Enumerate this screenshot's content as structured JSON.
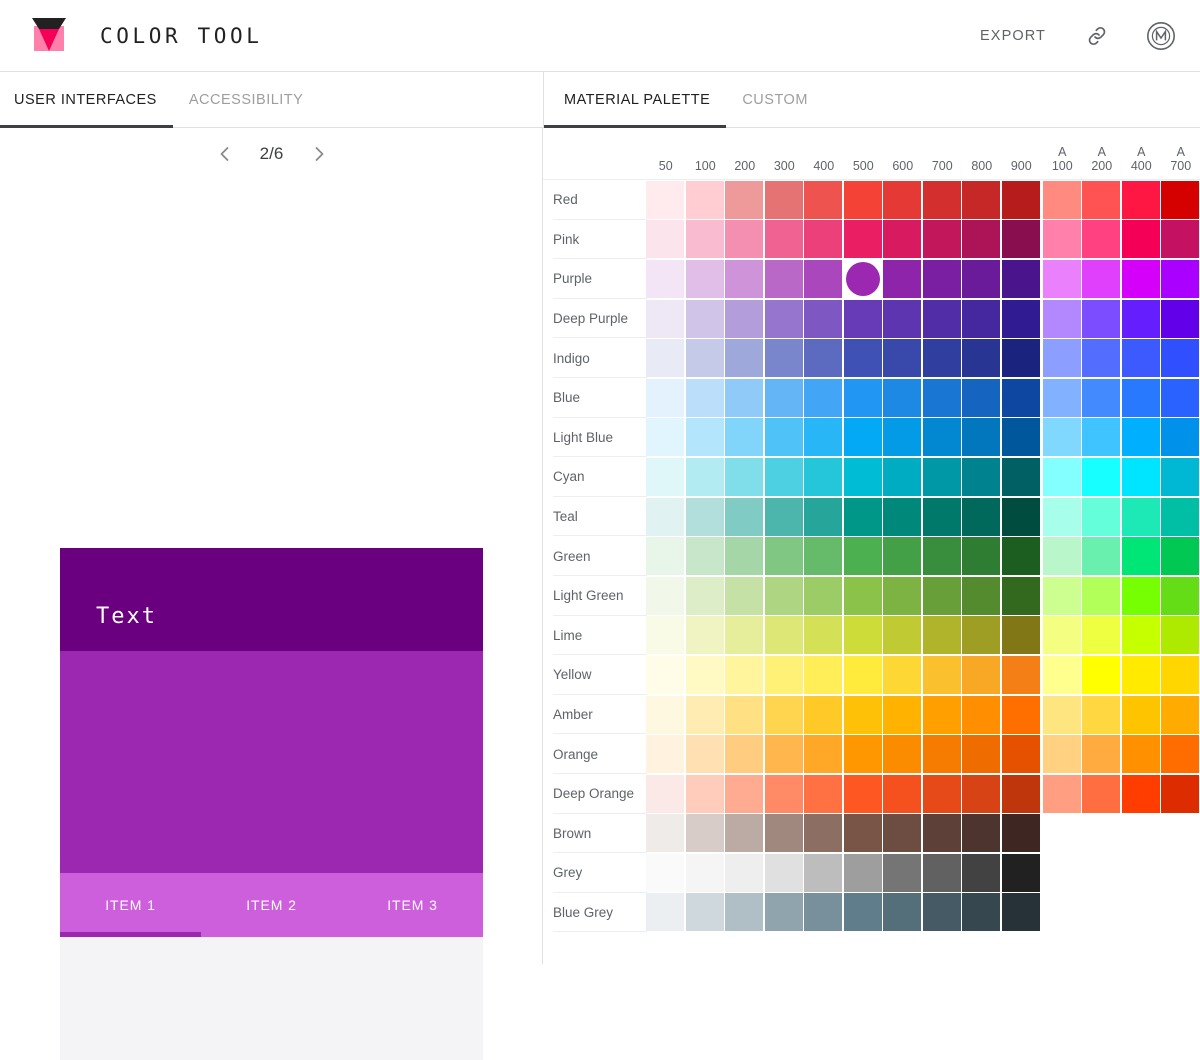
{
  "app": {
    "title": "COLOR TOOL",
    "logo_icon": "color-tool-logo-icon",
    "export_label": "EXPORT",
    "link_icon": "link-icon",
    "material_icon": "material-design-m-icon"
  },
  "left_tabs": [
    {
      "label": "USER INTERFACES",
      "active": true
    },
    {
      "label": "ACCESSIBILITY",
      "active": false
    }
  ],
  "right_tabs": [
    {
      "label": "MATERIAL PALETTE",
      "active": true
    },
    {
      "label": "CUSTOM",
      "active": false
    }
  ],
  "pager": {
    "prev_icon": "chevron-left-icon",
    "next_icon": "chevron-right-icon",
    "label": "2/6",
    "current": 2,
    "total": 6
  },
  "mockup": {
    "appbar_text": "Text",
    "appbar_color": "#6A0080",
    "body_color": "#9C27B0",
    "tabbar_color": "#CE5FDC",
    "indicator_color": "#9C27B0",
    "content_color": "#F4F4F6",
    "on_appbar_text_color": "#FFFFFF",
    "tabs": [
      {
        "label": "ITEM 1",
        "active": true
      },
      {
        "label": "ITEM 2",
        "active": false
      },
      {
        "label": "ITEM 3",
        "active": false
      }
    ]
  },
  "palette": {
    "selected": {
      "row": "Purple",
      "column": "500",
      "color": "#9C27B0"
    },
    "columns": [
      "50",
      "100",
      "200",
      "300",
      "400",
      "500",
      "600",
      "700",
      "800",
      "900"
    ],
    "accent_prefix": "A",
    "accent_columns": [
      "100",
      "200",
      "400",
      "700"
    ],
    "rows": [
      {
        "name": "Red",
        "shades": [
          "#FFEBEE",
          "#FFCDD2",
          "#EF9A9A",
          "#E57373",
          "#EF5350",
          "#F44336",
          "#E53935",
          "#D32F2F",
          "#C62828",
          "#B71C1C"
        ],
        "accents": [
          "#FF8A80",
          "#FF5252",
          "#FF1744",
          "#D50000"
        ]
      },
      {
        "name": "Pink",
        "shades": [
          "#FCE4EC",
          "#F8BBD0",
          "#F48FB1",
          "#F06292",
          "#EC407A",
          "#E91E63",
          "#D81B60",
          "#C2185B",
          "#AD1457",
          "#880E4F"
        ],
        "accents": [
          "#FF80AB",
          "#FF4081",
          "#F50057",
          "#C51162"
        ]
      },
      {
        "name": "Purple",
        "shades": [
          "#F3E5F5",
          "#E1BEE7",
          "#CE93D8",
          "#BA68C8",
          "#AB47BC",
          "#9C27B0",
          "#8E24AA",
          "#7B1FA2",
          "#6A1B9A",
          "#4A148C"
        ],
        "accents": [
          "#EA80FC",
          "#E040FB",
          "#D500F9",
          "#AA00FF"
        ]
      },
      {
        "name": "Deep Purple",
        "shades": [
          "#EDE7F6",
          "#D1C4E9",
          "#B39DDB",
          "#9575CD",
          "#7E57C2",
          "#673AB7",
          "#5E35B1",
          "#512DA8",
          "#4527A0",
          "#311B92"
        ],
        "accents": [
          "#B388FF",
          "#7C4DFF",
          "#651FFF",
          "#6200EA"
        ]
      },
      {
        "name": "Indigo",
        "shades": [
          "#E8EAF6",
          "#C5CAE9",
          "#9FA8DA",
          "#7986CB",
          "#5C6BC0",
          "#3F51B5",
          "#3949AB",
          "#303F9F",
          "#283593",
          "#1A237E"
        ],
        "accents": [
          "#8C9EFF",
          "#536DFE",
          "#3D5AFE",
          "#304FFE"
        ]
      },
      {
        "name": "Blue",
        "shades": [
          "#E3F2FD",
          "#BBDEFB",
          "#90CAF9",
          "#64B5F6",
          "#42A5F5",
          "#2196F3",
          "#1E88E5",
          "#1976D2",
          "#1565C0",
          "#0D47A1"
        ],
        "accents": [
          "#82B1FF",
          "#448AFF",
          "#2979FF",
          "#2962FF"
        ]
      },
      {
        "name": "Light Blue",
        "shades": [
          "#E1F5FE",
          "#B3E5FC",
          "#81D4FA",
          "#4FC3F7",
          "#29B6F6",
          "#03A9F4",
          "#039BE5",
          "#0288D1",
          "#0277BD",
          "#01579B"
        ],
        "accents": [
          "#80D8FF",
          "#40C4FF",
          "#00B0FF",
          "#0091EA"
        ]
      },
      {
        "name": "Cyan",
        "shades": [
          "#E0F7FA",
          "#B2EBF2",
          "#80DEEA",
          "#4DD0E1",
          "#26C6DA",
          "#00BCD4",
          "#00ACC1",
          "#0097A7",
          "#00838F",
          "#006064"
        ],
        "accents": [
          "#84FFFF",
          "#18FFFF",
          "#00E5FF",
          "#00B8D4"
        ]
      },
      {
        "name": "Teal",
        "shades": [
          "#E0F2F1",
          "#B2DFDB",
          "#80CBC4",
          "#4DB6AC",
          "#26A69A",
          "#009688",
          "#00897B",
          "#00796B",
          "#00695C",
          "#004D40"
        ],
        "accents": [
          "#A7FFEB",
          "#64FFDA",
          "#1DE9B6",
          "#00BFA5"
        ]
      },
      {
        "name": "Green",
        "shades": [
          "#E8F5E9",
          "#C8E6C9",
          "#A5D6A7",
          "#81C784",
          "#66BB6A",
          "#4CAF50",
          "#43A047",
          "#388E3C",
          "#2E7D32",
          "#1B5E20"
        ],
        "accents": [
          "#B9F6CA",
          "#69F0AE",
          "#00E676",
          "#00C853"
        ]
      },
      {
        "name": "Light Green",
        "shades": [
          "#F1F8E9",
          "#DCEDC8",
          "#C5E1A5",
          "#AED581",
          "#9CCC65",
          "#8BC34A",
          "#7CB342",
          "#689F38",
          "#558B2F",
          "#33691E"
        ],
        "accents": [
          "#CCFF90",
          "#B2FF59",
          "#76FF03",
          "#64DD17"
        ]
      },
      {
        "name": "Lime",
        "shades": [
          "#F9FBE7",
          "#F0F4C3",
          "#E6EE9C",
          "#DCE775",
          "#D4E157",
          "#CDDC39",
          "#C0CA33",
          "#AFB42B",
          "#9E9D24",
          "#827717"
        ],
        "accents": [
          "#F4FF81",
          "#EEFF41",
          "#C6FF00",
          "#AEEA00"
        ]
      },
      {
        "name": "Yellow",
        "shades": [
          "#FFFDE7",
          "#FFF9C4",
          "#FFF59D",
          "#FFF176",
          "#FFEE58",
          "#FFEB3B",
          "#FDD835",
          "#FBC02D",
          "#F9A825",
          "#F57F17"
        ],
        "accents": [
          "#FFFF8D",
          "#FFFF00",
          "#FFEA00",
          "#FFD600"
        ]
      },
      {
        "name": "Amber",
        "shades": [
          "#FFF8E1",
          "#FFECB3",
          "#FFE082",
          "#FFD54F",
          "#FFCA28",
          "#FFC107",
          "#FFB300",
          "#FFA000",
          "#FF8F00",
          "#FF6F00"
        ],
        "accents": [
          "#FFE57F",
          "#FFD740",
          "#FFC400",
          "#FFAB00"
        ]
      },
      {
        "name": "Orange",
        "shades": [
          "#FFF3E0",
          "#FFE0B2",
          "#FFCC80",
          "#FFB74D",
          "#FFA726",
          "#FF9800",
          "#FB8C00",
          "#F57C00",
          "#EF6C00",
          "#E65100"
        ],
        "accents": [
          "#FFD180",
          "#FFAB40",
          "#FF9100",
          "#FF6D00"
        ]
      },
      {
        "name": "Deep Orange",
        "shades": [
          "#FBE9E7",
          "#FFCCBC",
          "#FFAB91",
          "#FF8A65",
          "#FF7043",
          "#FF5722",
          "#F4511E",
          "#E64A19",
          "#D84315",
          "#BF360C"
        ],
        "accents": [
          "#FF9E80",
          "#FF6E40",
          "#FF3D00",
          "#DD2C00"
        ]
      },
      {
        "name": "Brown",
        "shades": [
          "#EFEBE9",
          "#D7CCC8",
          "#BCAAA4",
          "#A1887F",
          "#8D6E63",
          "#795548",
          "#6D4C41",
          "#5D4037",
          "#4E342E",
          "#3E2723"
        ],
        "accents": []
      },
      {
        "name": "Grey",
        "shades": [
          "#FAFAFA",
          "#F5F5F5",
          "#EEEEEE",
          "#E0E0E0",
          "#BDBDBD",
          "#9E9E9E",
          "#757575",
          "#616161",
          "#424242",
          "#212121"
        ],
        "accents": []
      },
      {
        "name": "Blue Grey",
        "shades": [
          "#ECEFF1",
          "#CFD8DC",
          "#B0BEC5",
          "#90A4AE",
          "#78909C",
          "#607D8B",
          "#546E7A",
          "#455A64",
          "#37474F",
          "#263238"
        ],
        "accents": []
      }
    ]
  }
}
